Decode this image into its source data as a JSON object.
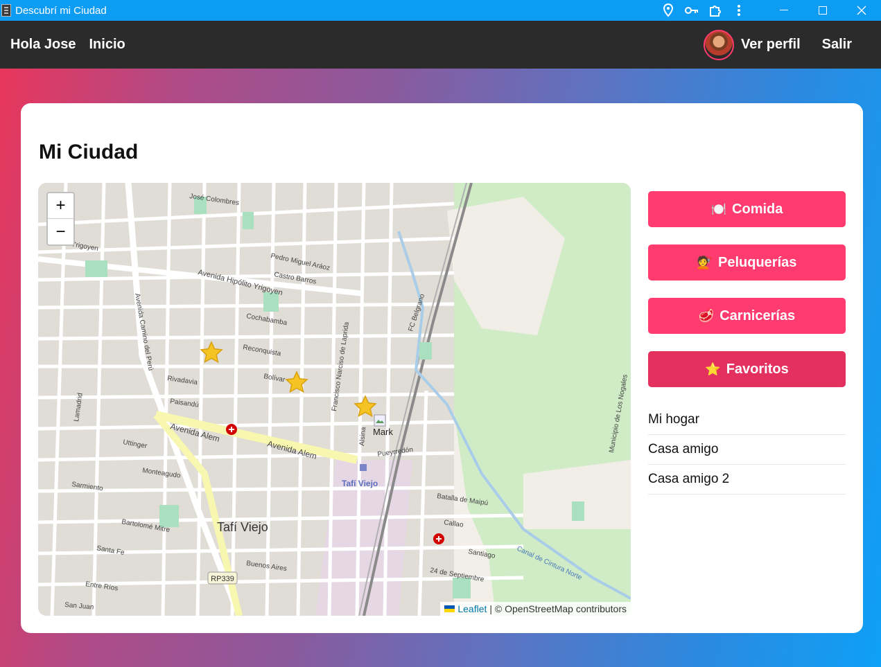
{
  "window": {
    "title": "Descubrí mi Ciudad",
    "icons": [
      "location-pin-icon",
      "key-icon",
      "extension-icon",
      "more-vertical-icon"
    ],
    "controls": [
      "minimize-icon",
      "maximize-icon",
      "close-icon"
    ]
  },
  "nav": {
    "greeting": "Hola Jose",
    "home": "Inicio",
    "profile": "Ver perfil",
    "logout": "Salir"
  },
  "page": {
    "title": "Mi Ciudad"
  },
  "map": {
    "zoom_in": "+",
    "zoom_out": "−",
    "attribution_link": "Leaflet",
    "attribution_text": "| © OpenStreetMap contributors",
    "marker_label": "Mark",
    "streets": [
      "José Colombres",
      "Avenida Hipólito Yrigoyen",
      "Pedro Miguel Aráoz",
      "Castro Barros",
      "Cochabamba",
      "Reconquista",
      "Bolívar",
      "Rivadavia",
      "Paisandú",
      "Avenida Alem",
      "Avenida Alem",
      "Uttinger",
      "Monteagudo",
      "Sarmiento",
      "Bartolomé Mitre",
      "Santa Fe",
      "Entre Ríos",
      "San Juan",
      "Avenida Camino del Perú",
      "Francisco Narciso de Laprida",
      "FC Belgrano",
      "Pueyrredón",
      "Batalla de Maipú",
      "Callao",
      "Santiago",
      "24 de Septiembre",
      "Canal de Cintura Norte",
      "Buenos Aires",
      "Lamadrid",
      "Hipólito Yrigoyen",
      "Alsina",
      "Municipio de Los Nogales"
    ],
    "places": [
      "Tafí Viejo",
      "RP339"
    ]
  },
  "categories": [
    {
      "label": "Comida",
      "icon": "🍽️",
      "icon_name": "plate-icon"
    },
    {
      "label": "Peluquerías",
      "icon": "💇",
      "icon_name": "haircut-icon"
    },
    {
      "label": "Carnicerías",
      "icon": "🥩",
      "icon_name": "meat-icon"
    },
    {
      "label": "Favoritos",
      "icon": "⭐",
      "icon_name": "star-icon"
    }
  ],
  "favorites": [
    "Mi hogar",
    "Casa amigo",
    "Casa amigo 2"
  ],
  "colors": {
    "titlebar": "#0d9cf3",
    "navbar": "#2b2b2b",
    "button": "#ff3b6f",
    "button_active": "#e4305f"
  }
}
